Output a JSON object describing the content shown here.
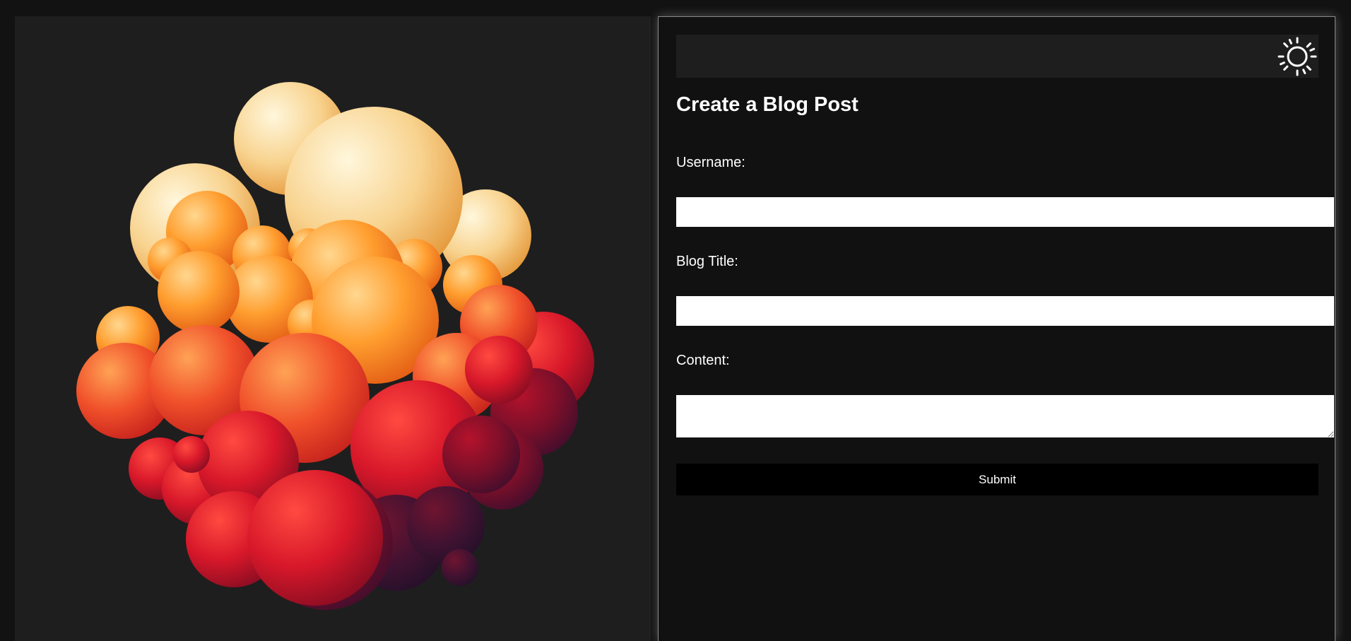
{
  "form": {
    "title": "Create a Blog Post",
    "username_label": "Username:",
    "username_value": "",
    "blog_title_label": "Blog Title:",
    "blog_title_value": "",
    "content_label": "Content:",
    "content_value": "",
    "submit_label": "Submit"
  },
  "icons": {
    "theme_toggle": "sun-icon",
    "hero_image": "bubble-cloud-illustration"
  },
  "colors": {
    "background": "#121212",
    "panel": "#1e1e1e",
    "text": "#ffffff",
    "button": "#000000"
  }
}
